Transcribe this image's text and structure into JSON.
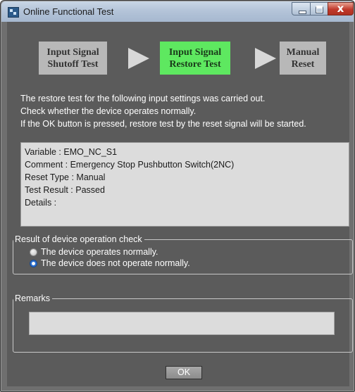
{
  "window": {
    "title": "Online Functional Test",
    "close_label": "x"
  },
  "steps": [
    {
      "label_line1": "Input Signal",
      "label_line2": "Shutoff Test",
      "state": "inactive"
    },
    {
      "label_line1": "Input Signal",
      "label_line2": "Restore Test",
      "state": "active"
    },
    {
      "label_line1": "Manual",
      "label_line2": "Reset",
      "state": "inactive"
    }
  ],
  "description": {
    "line1": "The restore test for the following input settings was carried out.",
    "line2": "Check whether the device operates normally.",
    "line3": "If the OK button is pressed, restore test by the reset signal will be started."
  },
  "info": {
    "variable": "Variable : EMO_NC_S1",
    "comment": "Comment : Emergency Stop Pushbutton Switch(2NC)",
    "reset_type": "Reset Type : Manual",
    "test_result": "Test Result : Passed",
    "details": "Details :"
  },
  "check_group": {
    "legend": "Result of device operation check",
    "options": [
      {
        "label": "The device operates normally.",
        "selected": false
      },
      {
        "label": "The device does not operate normally.",
        "selected": true
      }
    ]
  },
  "remarks": {
    "legend": "Remarks",
    "value": ""
  },
  "ok_button": "OK",
  "colors": {
    "active_step": "#5ee860",
    "inactive_step": "#b8b8b8",
    "background": "#5b5b5b",
    "selected_radio": "#2a6fd0"
  }
}
